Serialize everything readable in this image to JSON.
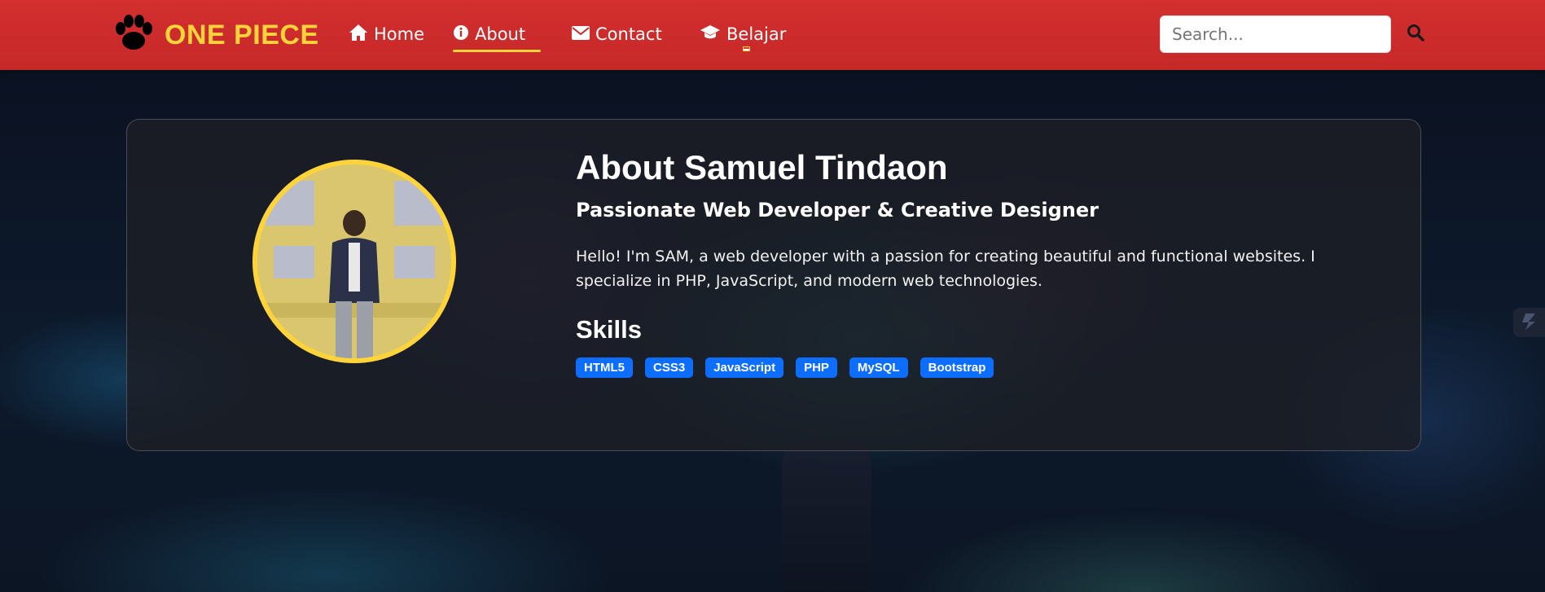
{
  "brand": {
    "icon": "paw-icon",
    "name": "ONE PIECE",
    "color": "#ffd43b"
  },
  "nav": {
    "items": [
      {
        "icon": "home-icon",
        "label": "Home",
        "active": false
      },
      {
        "icon": "info-circle-icon",
        "label": "About",
        "active": true
      },
      {
        "icon": "envelope-icon",
        "label": "Contact",
        "active": false
      },
      {
        "icon": "graduation-cap-icon",
        "label": "Belajar",
        "active": false
      }
    ],
    "accent": "#d32f2f",
    "active_underline": "#ffd43b"
  },
  "search": {
    "placeholder": "Search...",
    "value": "",
    "button_icon": "search-icon"
  },
  "about": {
    "title": "About Samuel Tindaon",
    "subtitle": "Passionate Web Developer & Creative Designer",
    "bio": "Hello! I'm SAM, a web developer with a passion for creating beautiful and functional websites. I specialize in PHP, JavaScript, and modern web technologies.",
    "avatar_border": "#ffd43b",
    "skills_heading": "Skills",
    "skills": [
      "HTML5",
      "CSS3",
      "JavaScript",
      "PHP",
      "MySQL",
      "Bootstrap"
    ],
    "badge_color": "#0d6efd"
  },
  "side_widget": {
    "icon": "cube-icon"
  }
}
